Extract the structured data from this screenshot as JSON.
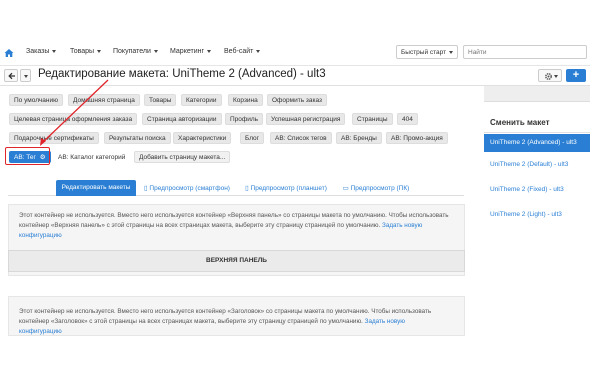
{
  "nav": {
    "items": [
      "Заказы",
      "Товары",
      "Покупатели",
      "Маркетинг",
      "Веб-сайт"
    ],
    "quick_start": "Быстрый старт",
    "search_placeholder": "Найти"
  },
  "header": {
    "title": "Редактирование макета: UniTheme 2 (Advanced) - ult3"
  },
  "layout_tabs": {
    "row1": [
      "По умолчанию",
      "Домашняя страница",
      "Товары",
      "Категории",
      "Корзина",
      "Оформить заказ"
    ],
    "row2": [
      "Целевая страница оформления заказа",
      "Страница авторизации",
      "Профиль",
      "Успешная регистрация",
      "Страницы",
      "404"
    ],
    "row3": [
      "Подарочные сертификаты",
      "Результаты поиска",
      "Характеристики",
      "Блог",
      "AB: Список тегов",
      "AB: Бренды",
      "AB: Промо-акция"
    ],
    "active": "AB: Тег",
    "row4_rest": [
      "AB: Каталог категорий"
    ],
    "add_page": "Добавить страницу макета..."
  },
  "mode_tabs": [
    "Редактировать макеты",
    "Предпросмотр (смартфон)",
    "Предпросмотр (планшет)",
    "Предпросмотр (ПК)"
  ],
  "containers": {
    "top_note_1": "Этот контейнер не используется. Вместо него используется контейнер «Верхняя панель» со страницы макета по умолчанию. Чтобы использовать контейнер «Верхняя панель» с этой страницы на всех страницах макета, выберите эту страницу страницей по умолчанию.",
    "top_link": "Задать новую конфигурацию",
    "top_panel_label": "ВЕРХНЯЯ ПАНЕЛЬ",
    "header_note_1": "Этот контейнер не используется. Вместо него используется контейнер «Заголовок» со страницы макета по умолчанию. Чтобы использовать контейнер «Заголовок» с этой страницы на всех страницах макета, выберите эту страницу страницей по умолчанию.",
    "header_link": "Задать новую конфигурацию"
  },
  "sidebar": {
    "title": "Сменить макет",
    "items": [
      {
        "label": "UniTheme 2 (Advanced) - ult3",
        "active": true
      },
      {
        "label": "UniTheme 2 (Default) - ult3",
        "active": false
      },
      {
        "label": "UniTheme 2 (Fixed) - ult3",
        "active": false
      },
      {
        "label": "UniTheme 2 (Light) - ult3",
        "active": false
      }
    ]
  },
  "colors": {
    "accent": "#2a7fd4",
    "highlight": "#e0252a"
  }
}
